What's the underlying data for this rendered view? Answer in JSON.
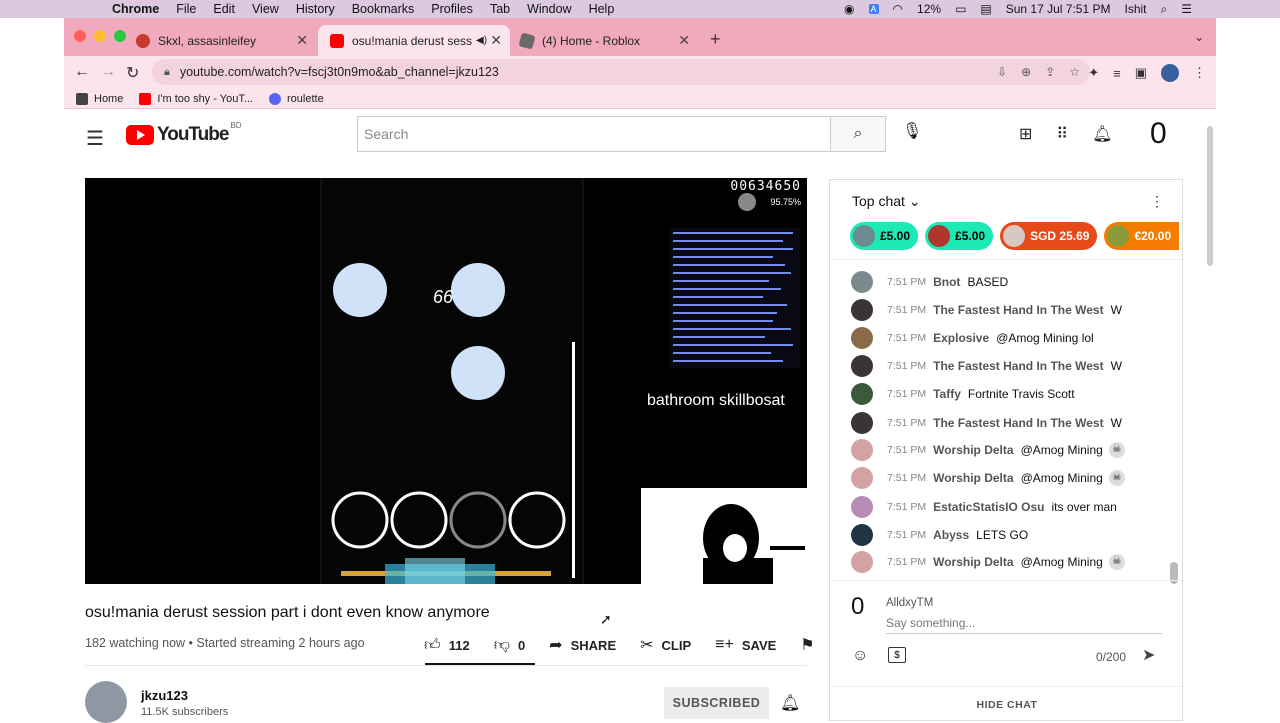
{
  "macos": {
    "app": "Chrome",
    "menu": [
      "File",
      "Edit",
      "View",
      "History",
      "Bookmarks",
      "Profiles",
      "Tab",
      "Window",
      "Help"
    ],
    "battery": "12%",
    "datetime": "Sun 17 Jul  7:51 PM",
    "user": "Ishit"
  },
  "tabs": [
    {
      "title": "Skxl, assasinleifey",
      "fav_color": "#c7382d"
    },
    {
      "title": "osu!mania derust session p",
      "fav_color": "#ff0000"
    },
    {
      "title": "(4) Home - Roblox",
      "fav_color": "#6a6a6a"
    }
  ],
  "url": "youtube.com/watch?v=fscj3t0n9mo&ab_channel=jkzu123",
  "bookmarks": [
    {
      "label": "Home",
      "color": "#444444"
    },
    {
      "label": "I'm too shy - YouT...",
      "color": "#ff0000"
    },
    {
      "label": "roulette",
      "color": "#5865f2"
    }
  ],
  "youtube": {
    "logo_text": "YouTube",
    "region": "BD",
    "search_placeholder": "Search",
    "account_initial": "0"
  },
  "video": {
    "title": "osu!mania derust session part i dont even know anymore",
    "meta": "182 watching now • Started streaming 2 hours ago",
    "likes": "112",
    "dislikes": "0",
    "share": "SHARE",
    "clip": "CLIP",
    "save": "SAVE",
    "overlay": {
      "score": "00634650",
      "accuracy": "95.75%",
      "combo": "66",
      "caption": "bathroom skillbosat"
    }
  },
  "channel": {
    "name": "jkzu123",
    "subs": "11.5K subscribers",
    "subscribe_label": "SUBSCRIBED"
  },
  "chat": {
    "header": "Top chat",
    "superchats": [
      {
        "amount": "£5.00",
        "bg": "#1de9b6",
        "fg": "#000000",
        "av": "#6e8a91"
      },
      {
        "amount": "£5.00",
        "bg": "#1de9b6",
        "fg": "#000000",
        "av": "#b0352f"
      },
      {
        "amount": "SGD 25.69",
        "bg": "#e64a19",
        "fg": "#ffffff",
        "av": "#d9c7c2"
      },
      {
        "amount": "€20.00",
        "bg": "#f57c00",
        "fg": "#ffffff",
        "av": "#8a9a3a"
      }
    ],
    "messages": [
      {
        "time": "7:51 PM",
        "author": "Bnot",
        "text": "BASED",
        "av": "#7c8a8e",
        "skull": false
      },
      {
        "time": "7:51 PM",
        "author": "The Fastest Hand In The West",
        "text": "W",
        "av": "#3b3434",
        "skull": false
      },
      {
        "time": "7:51 PM",
        "author": "Explosive",
        "text": "@Amog Mining lol",
        "av": "#8b6a4a",
        "skull": false
      },
      {
        "time": "7:51 PM",
        "author": "The Fastest Hand In The West",
        "text": "W",
        "av": "#3b3434",
        "skull": false
      },
      {
        "time": "7:51 PM",
        "author": "Taffy",
        "text": "Fortnite Travis Scott",
        "av": "#3b5a3b",
        "skull": false
      },
      {
        "time": "7:51 PM",
        "author": "The Fastest Hand In The West",
        "text": "W",
        "av": "#3b3434",
        "skull": false
      },
      {
        "time": "7:51 PM",
        "author": "Worship Delta",
        "text": "@Amog Mining",
        "av": "#d4a2a2",
        "skull": true
      },
      {
        "time": "7:51 PM",
        "author": "Worship Delta",
        "text": "@Amog Mining",
        "av": "#d4a2a2",
        "skull": true
      },
      {
        "time": "7:51 PM",
        "author": "EstaticStatisIO Osu",
        "text": "its over man",
        "av": "#b78db6",
        "skull": false
      },
      {
        "time": "7:51 PM",
        "author": "Abyss",
        "text": "LETS GO",
        "av": "#223344",
        "skull": false
      },
      {
        "time": "7:51 PM",
        "author": "Worship Delta",
        "text": "@Amog Mining",
        "av": "#d4a2a2",
        "skull": true
      }
    ],
    "input_user": "AlldxyTM",
    "input_initial": "0",
    "input_placeholder": "Say something...",
    "counter": "0/200",
    "hide_label": "HIDE CHAT"
  }
}
